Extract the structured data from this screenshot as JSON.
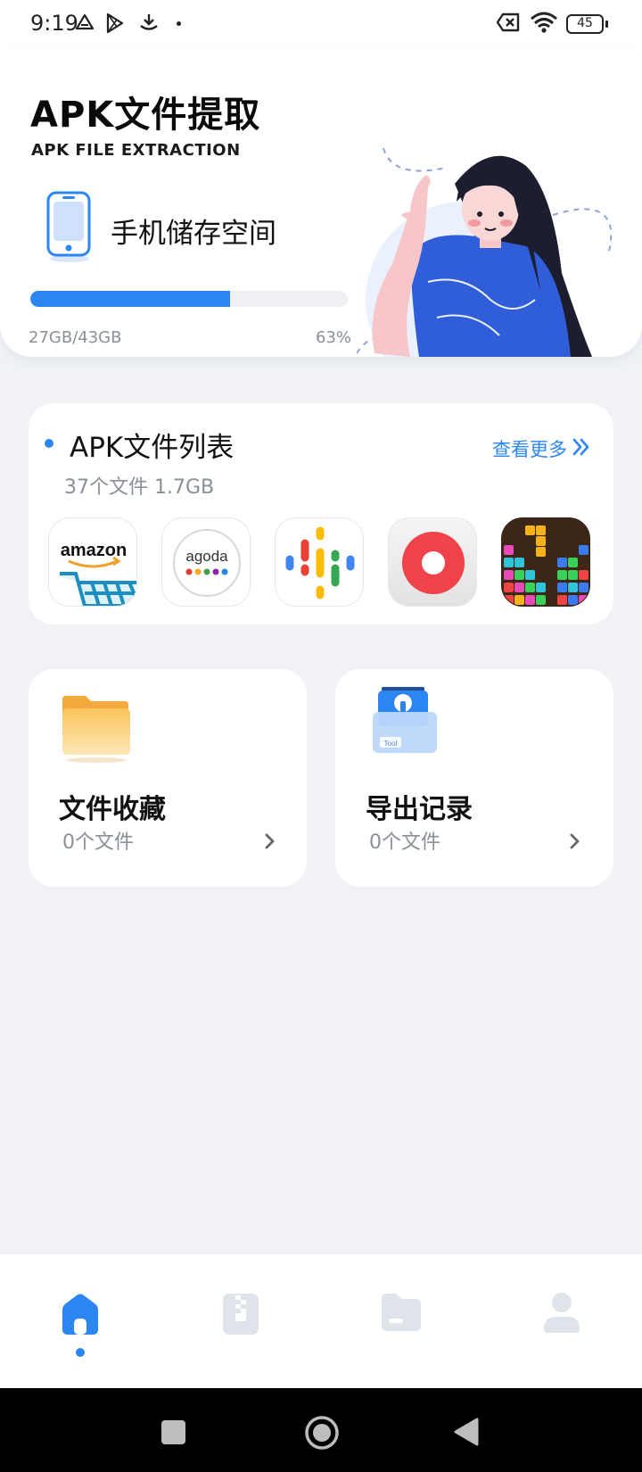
{
  "status_bar": {
    "time": "9:19",
    "battery": "45",
    "icons": [
      "drive-icon",
      "play-store-icon",
      "download-icon",
      "dot-icon",
      "no-sim-icon",
      "wifi-icon",
      "battery-icon"
    ]
  },
  "header": {
    "title": "APK文件提取",
    "subtitle": "APK FILE EXTRACTION",
    "storage_label": "手机储存空间",
    "storage_used": "27GB/43GB",
    "storage_percent": "63%",
    "storage_fraction": 0.63
  },
  "apk_list": {
    "title": "APK文件列表",
    "count": "37个文件  1.7GB",
    "see_more": "查看更多",
    "apps": [
      {
        "name": "amazon-app-icon",
        "label": "amazon"
      },
      {
        "name": "agoda-app-icon",
        "label": "agoda"
      },
      {
        "name": "google-podcasts-app-icon"
      },
      {
        "name": "screen-recorder-app-icon"
      },
      {
        "name": "block-puzzle-app-icon"
      }
    ]
  },
  "features": [
    {
      "title": "文件收藏",
      "count": "0个文件",
      "icon": "folder-icon"
    },
    {
      "title": "导出记录",
      "count": "0个文件",
      "icon": "toolbox-icon"
    }
  ],
  "bottom_nav": {
    "items": [
      "home-icon",
      "zip-file-icon",
      "folder-file-icon",
      "profile-icon"
    ],
    "active": "home-icon",
    "accent": "#2b86f2"
  },
  "colors": {
    "accent": "#2b86f2",
    "background": "#f0f2f6",
    "card": "#ffffff",
    "muted_text": "#8a8f98"
  }
}
